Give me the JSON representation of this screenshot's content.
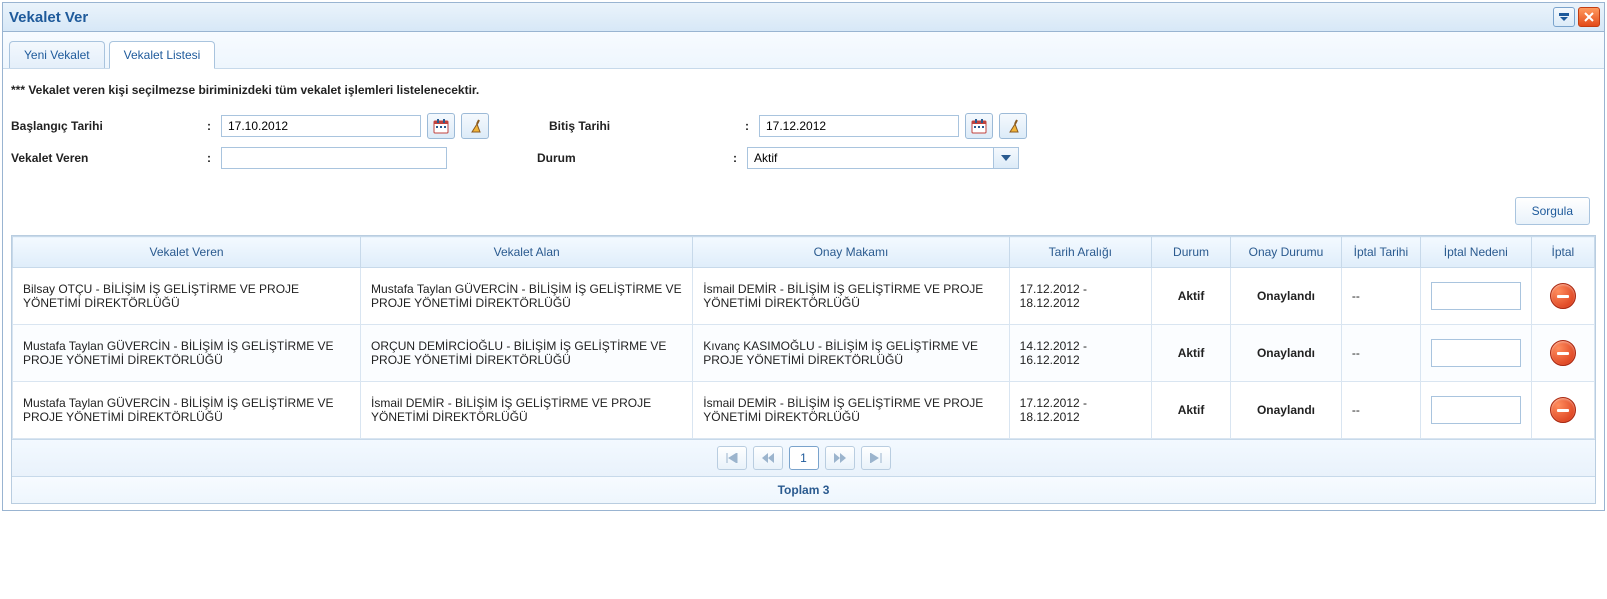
{
  "window": {
    "title": "Vekalet Ver"
  },
  "tabs": {
    "new": "Yeni Vekalet",
    "list": "Vekalet Listesi"
  },
  "hint": "*** Vekalet veren kişi seçilmezse biriminizdeki tüm vekalet işlemleri listelenecektir.",
  "form": {
    "start_label": "Başlangıç Tarihi",
    "start_value": "17.10.2012",
    "end_label": "Bitiş Tarihi",
    "end_value": "17.12.2012",
    "grantor_label": "Vekalet Veren",
    "grantor_value": "",
    "status_label": "Durum",
    "status_value": "Aktif"
  },
  "actions": {
    "query": "Sorgula"
  },
  "columns": {
    "grantor": "Vekalet Veren",
    "grantee": "Vekalet Alan",
    "authority": "Onay Makamı",
    "date_range": "Tarih Aralığı",
    "status": "Durum",
    "approval": "Onay Durumu",
    "cancel_date": "İptal Tarihi",
    "cancel_reason": "İptal Nedeni",
    "cancel": "İptal"
  },
  "rows": [
    {
      "grantor": "Bilsay OTÇU - BİLİŞİM İŞ GELİŞTİRME VE PROJE YÖNETİMİ DİREKTÖRLÜĞÜ",
      "grantee": "Mustafa Taylan GÜVERCİN - BİLİŞİM İŞ GELİŞTİRME VE PROJE YÖNETİMİ DİREKTÖRLÜĞÜ",
      "authority": "İsmail DEMİR - BİLİŞİM İŞ GELİŞTİRME VE PROJE YÖNETİMİ DİREKTÖRLÜĞÜ",
      "date_range": "17.12.2012 - 18.12.2012",
      "status": "Aktif",
      "approval": "Onaylandı",
      "cancel_date": "--",
      "cancel_reason": ""
    },
    {
      "grantor": "Mustafa Taylan GÜVERCİN - BİLİŞİM İŞ GELİŞTİRME VE PROJE YÖNETİMİ DİREKTÖRLÜĞÜ",
      "grantee": "ORÇUN DEMİRCİOĞLU - BİLİŞİM İŞ GELİŞTİRME VE PROJE YÖNETİMİ DİREKTÖRLÜĞÜ",
      "authority": "Kıvanç KASIMOĞLU - BİLİŞİM İŞ GELİŞTİRME VE PROJE YÖNETİMİ DİREKTÖRLÜĞÜ",
      "date_range": "14.12.2012 - 16.12.2012",
      "status": "Aktif",
      "approval": "Onaylandı",
      "cancel_date": "--",
      "cancel_reason": ""
    },
    {
      "grantor": "Mustafa Taylan GÜVERCİN - BİLİŞİM İŞ GELİŞTİRME VE PROJE YÖNETİMİ DİREKTÖRLÜĞÜ",
      "grantee": "İsmail DEMİR - BİLİŞİM İŞ GELİŞTİRME VE PROJE YÖNETİMİ DİREKTÖRLÜĞÜ",
      "authority": "İsmail DEMİR - BİLİŞİM İŞ GELİŞTİRME VE PROJE YÖNETİMİ DİREKTÖRLÜĞÜ",
      "date_range": "17.12.2012 - 18.12.2012",
      "status": "Aktif",
      "approval": "Onaylandı",
      "cancel_date": "--",
      "cancel_reason": ""
    }
  ],
  "pager": {
    "page": "1"
  },
  "total": {
    "label": "Toplam 3"
  }
}
